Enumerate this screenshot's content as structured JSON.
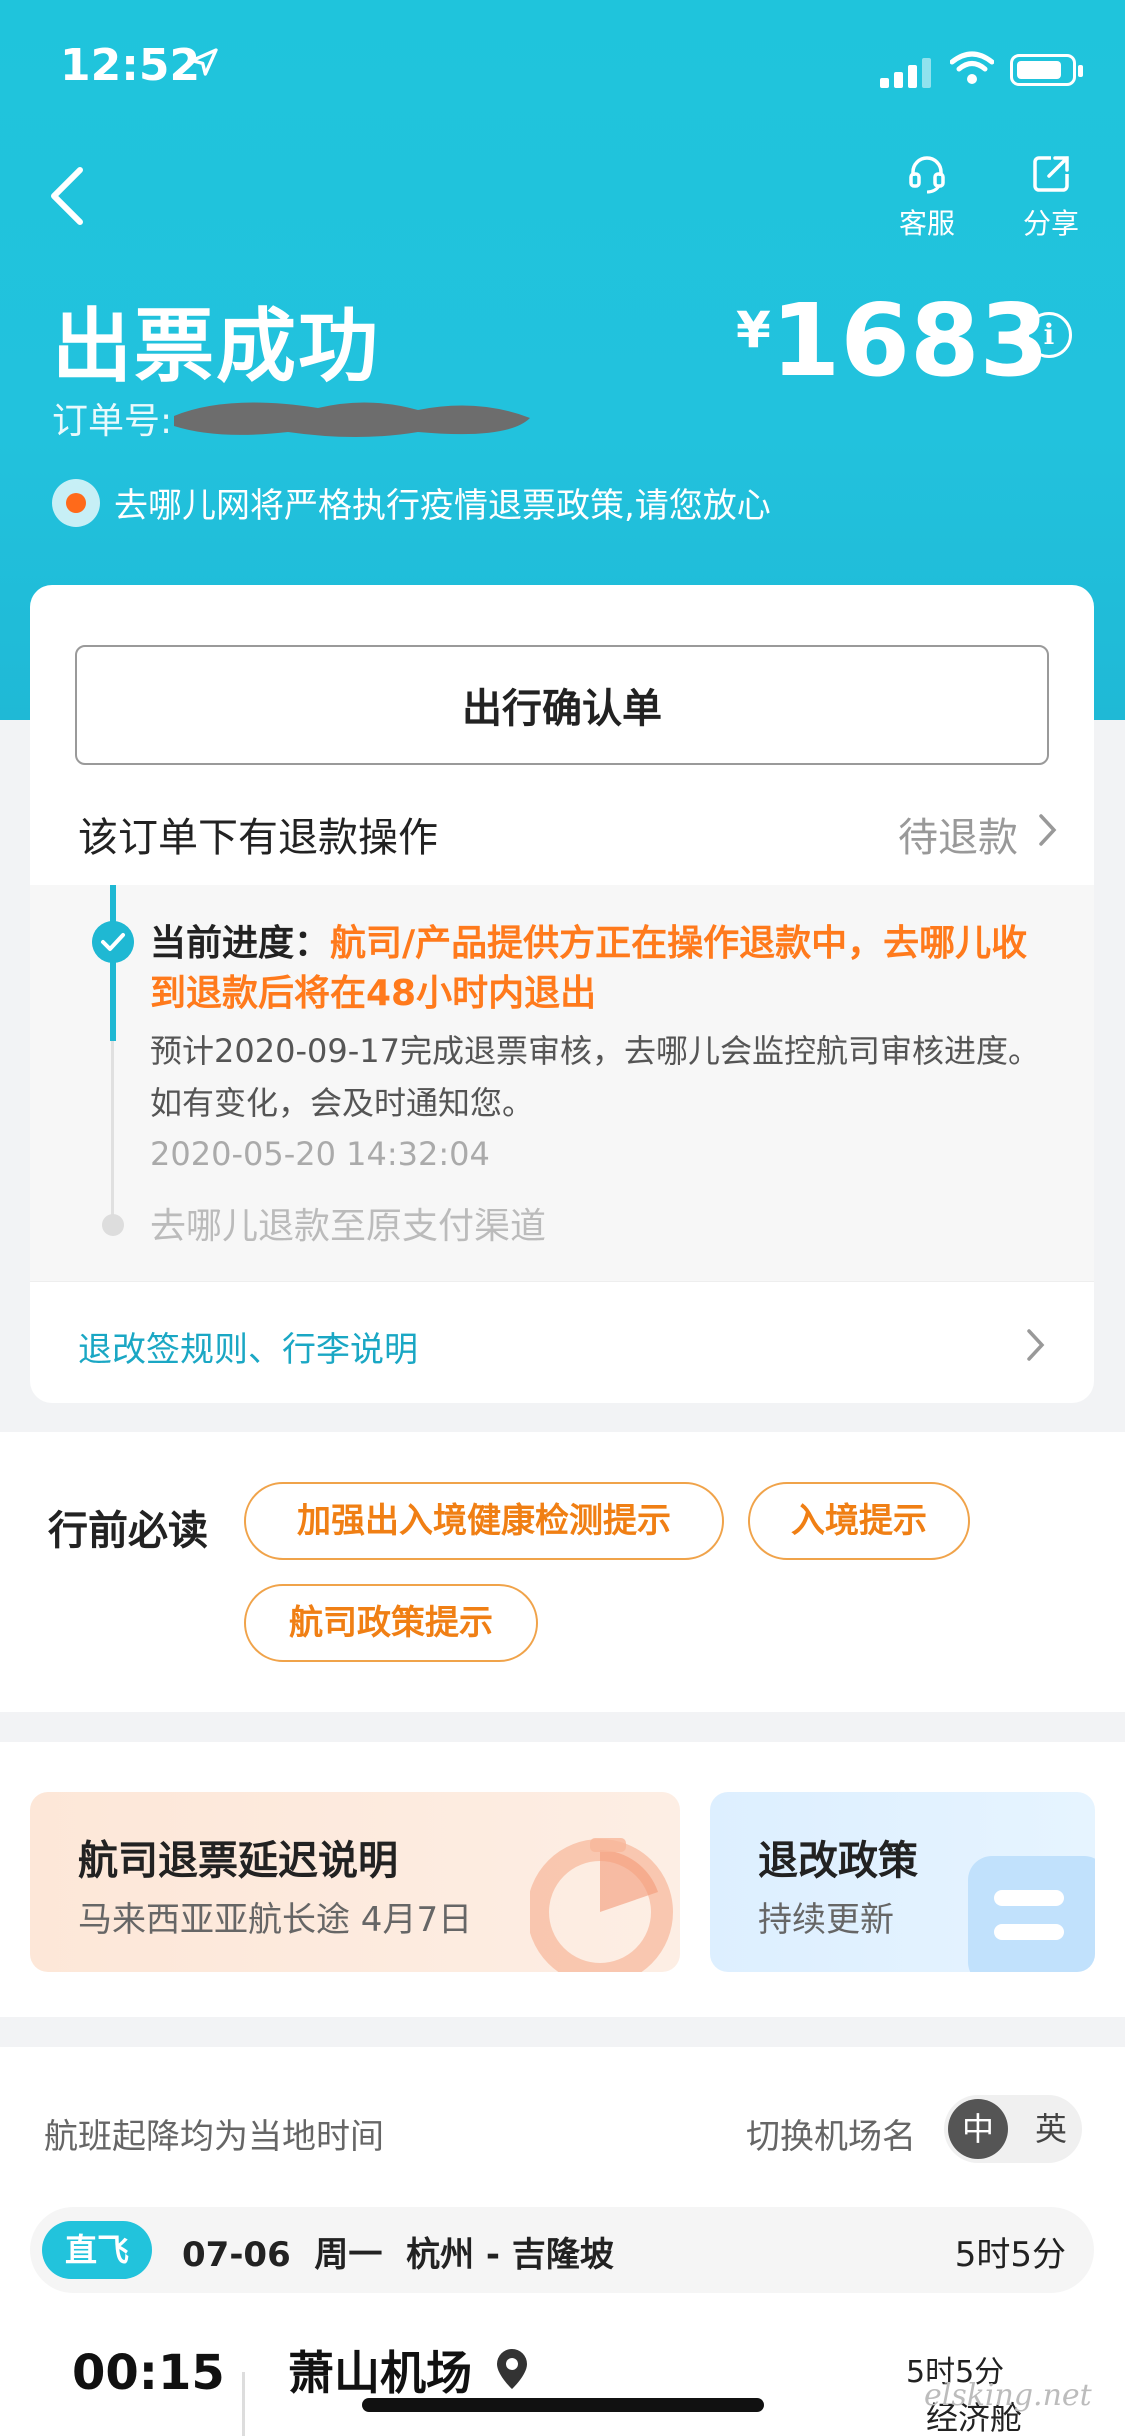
{
  "status_bar": {
    "time": "12:52"
  },
  "header": {
    "service_label": "客服",
    "share_label": "分享",
    "title": "出票成功",
    "currency": "¥",
    "price": "1683",
    "info_symbol": "i",
    "order_label": "订单号:",
    "notice": "去哪儿网将严格执行疫情退票政策,请您放心"
  },
  "card": {
    "confirm_button": "出行确认单",
    "refund_label": "该订单下有退款操作",
    "refund_status": "待退款",
    "progress": {
      "current_key": "当前进度：",
      "current_value": "航司/产品提供方正在操作退款中，去哪儿收到退款后将在48小时内退出",
      "description": "预计2020-09-17完成退票审核，去哪儿会监控航司审核进度。如有变化，会及时通知您。",
      "timestamp": "2020-05-20 14:32:04",
      "next_step": "去哪儿退款至原支付渠道"
    },
    "rules_link": "退改签规则、行李说明"
  },
  "must_read": {
    "label": "行前必读",
    "tags": [
      "加强出入境健康检测提示",
      "入境提示",
      "航司政策提示"
    ]
  },
  "promos": [
    {
      "title": "航司退票延迟说明",
      "subtitle": "马来西亚亚航长途 4月7日"
    },
    {
      "title": "退改政策",
      "subtitle": "持续更新"
    }
  ],
  "flight": {
    "local_time_note": "航班起降均为当地时间",
    "switch_label": "切换机场名",
    "toggle_on": "中",
    "toggle_off": "英",
    "direct_tag": "直飞",
    "route_info": "07-06  周一  杭州 - 吉隆坡",
    "duration_total": "5时5分",
    "dep_time": "00:15",
    "dep_airport": "萧山机场",
    "duration": "5时5分",
    "cabin": "经济舱"
  },
  "watermark": "elsking.net",
  "colors": {
    "header": "#22c2dd",
    "accent_orange": "#ff7a1c",
    "link": "#1aa7c4"
  }
}
